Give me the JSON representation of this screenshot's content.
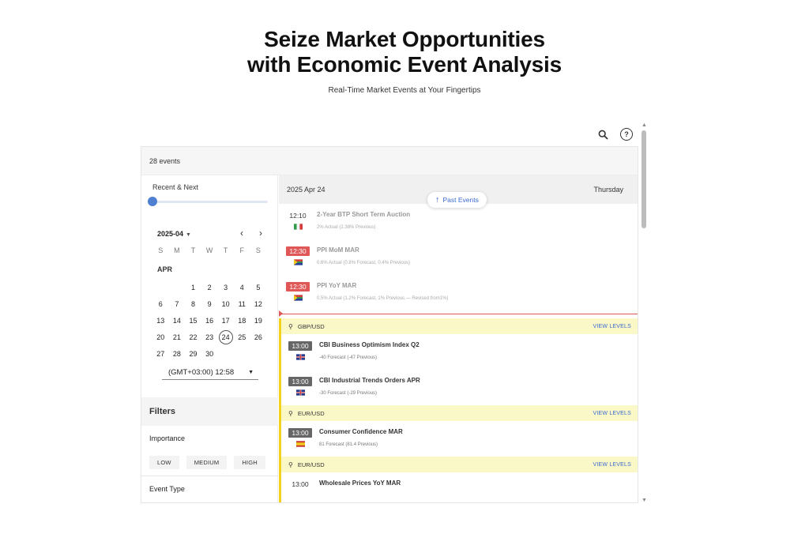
{
  "hero": {
    "title_line1": "Seize Market Opportunities",
    "title_line2": "with Economic Event Analysis",
    "subtitle": "Real-Time Market Events at Your Fingertips"
  },
  "toolbar": {
    "search_icon": "search-icon",
    "help_icon": "help-icon"
  },
  "widget": {
    "event_count": "28 events",
    "sidebar": {
      "range_label": "Recent & Next",
      "slider_value": 0,
      "calendar": {
        "month_select": "2025-04",
        "weekdays": [
          "S",
          "M",
          "T",
          "W",
          "T",
          "F",
          "S"
        ],
        "month_label": "APR",
        "days": [
          "",
          "",
          "1",
          "2",
          "3",
          "4",
          "5",
          "6",
          "7",
          "8",
          "9",
          "10",
          "11",
          "12",
          "13",
          "14",
          "15",
          "16",
          "17",
          "18",
          "19",
          "20",
          "21",
          "22",
          "23",
          "24",
          "25",
          "26",
          "27",
          "28",
          "29",
          "30"
        ],
        "selected_day": "24"
      },
      "timezone": "(GMT+03:00) 12:58",
      "filters": {
        "title": "Filters",
        "importance_label": "Importance",
        "importance_options": [
          "LOW",
          "MEDIUM",
          "HIGH"
        ],
        "event_type_label": "Event Type"
      }
    },
    "main": {
      "date": "2025 Apr 24",
      "weekday": "Thursday",
      "past_events_label": "Past Events",
      "past_events": [
        {
          "time": "12:10",
          "style": "plain",
          "flag": "IT",
          "title": "2-Year BTP Short Term Auction",
          "detail": "2% Actual (2.38% Previous)"
        },
        {
          "time": "12:30",
          "style": "red",
          "flag": "ZA",
          "title": "PPI MoM MAR",
          "detail": "0.6% Actual (0.8% Forecast, 0.4% Previous)"
        },
        {
          "time": "12:30",
          "style": "red",
          "flag": "ZA",
          "title": "PPI YoY MAR",
          "detail": "0.5% Actual (1.2% Forecast, 1% Previous — Revised from1%)"
        }
      ],
      "groups": [
        {
          "pair": "GBP/USD",
          "view_levels": "VIEW LEVELS",
          "events": [
            {
              "time": "13:00",
              "style": "grey",
              "flag": "GB",
              "title": "CBI Business Optimism Index Q2",
              "detail": "-40 Forecast (-47 Previous)"
            },
            {
              "time": "13:00",
              "style": "grey",
              "flag": "GB",
              "title": "CBI Industrial Trends Orders APR",
              "detail": "-30 Forecast (-29 Previous)"
            }
          ]
        },
        {
          "pair": "EUR/USD",
          "view_levels": "VIEW LEVELS",
          "events": [
            {
              "time": "13:00",
              "style": "grey",
              "flag": "ES",
              "title": "Consumer Confidence MAR",
              "detail": "81 Forecast (81.4 Previous)"
            }
          ]
        },
        {
          "pair": "EUR/USD",
          "view_levels": "VIEW LEVELS",
          "events": [
            {
              "time": "13:00",
              "style": "plain",
              "flag": "",
              "title": "Wholesale Prices YoY MAR",
              "detail": ""
            }
          ]
        }
      ]
    }
  },
  "colors": {
    "accent_blue": "#4e7fd0",
    "link_blue": "#3b6bd1",
    "time_red": "#e05757",
    "group_yellow": "#f2d21c",
    "group_bg": "#fbf8c7"
  }
}
